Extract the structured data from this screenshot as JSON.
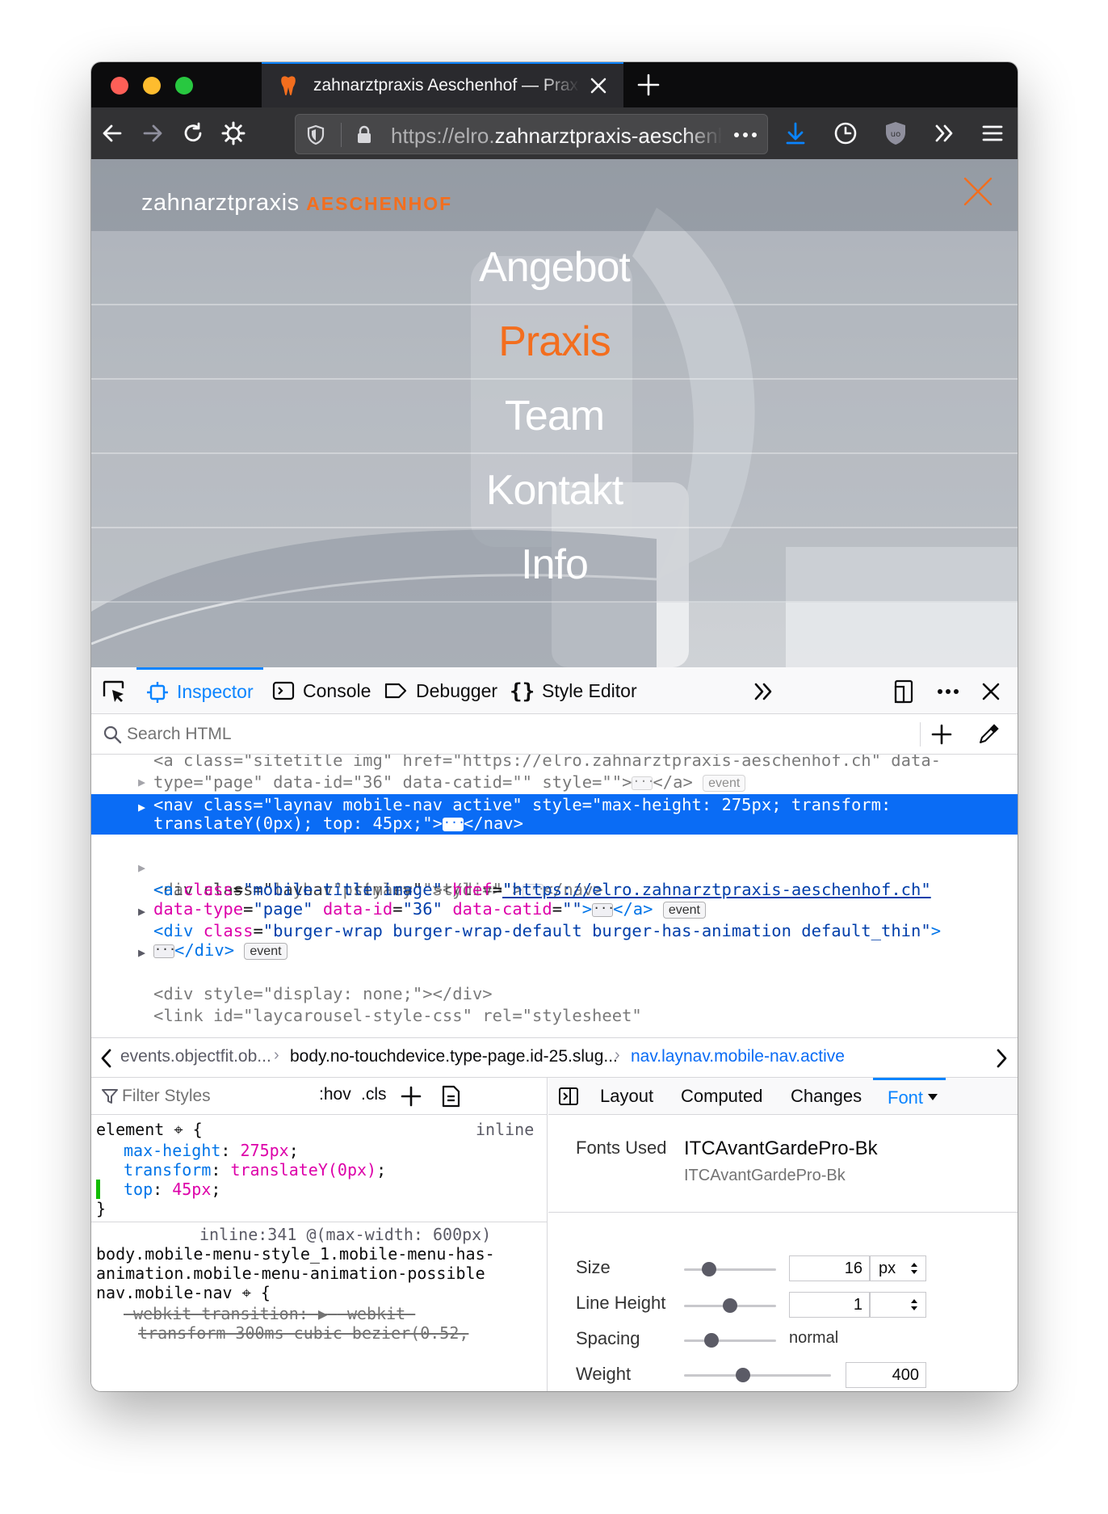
{
  "browser": {
    "tab_title": "zahnarztpraxis Aeschenhof — Praxis",
    "url_prefix": "https://elro.",
    "url_domain": "zahnarztpraxis-aeschenhof.ch"
  },
  "page": {
    "brand_light": "zahnarztpraxis ",
    "brand_bold": "AESCHENHOF",
    "accent_color": "#f36e1e",
    "menu": [
      {
        "label": "Angebot",
        "active": false
      },
      {
        "label": "Praxis",
        "active": true
      },
      {
        "label": "Team",
        "active": false
      },
      {
        "label": "Kontakt",
        "active": false
      },
      {
        "label": "Info",
        "active": false
      }
    ]
  },
  "devtools": {
    "tabs": {
      "inspector": "Inspector",
      "console": "Console",
      "debugger": "Debugger",
      "style_editor": "Style Editor"
    },
    "search_placeholder": "Search HTML",
    "markup": {
      "l0a": "<a class=\"sitetitle img\" href=\"https://elro.zahnarztpraxis-aeschenhof.ch\" data-",
      "l0b": "type=\"page\" data-id=\"36\" data-catid=\"\" style=\"\">",
      "l0c": "</a>",
      "sel1": "<nav class=\"laynav mobile-nav active\" style=\"max-height: 275px; transform:",
      "sel2": "translateY(0px); top: 45px;\">",
      "sel3": "</nav>",
      "l2a": "<nav class=\"laynav primary\" style=\"\">",
      "l2b": "</nav>",
      "l3": "<div class=\"navbar\" style=\"\"></div>",
      "l4_tag": "<a ",
      "l4_a1": "class",
      "l4_v1": "\"mobile-title image\"",
      "l4_a2": "href",
      "l4_v2": "\"https://elro.zahnarztpraxis-aeschenhof.ch\"",
      "l5_a1": "data-type",
      "l5_v1": "\"page\"",
      "l5_a2": "data-id",
      "l5_v2": "\"36\"",
      "l5_a3": "data-catid",
      "l5_v3": "\"\"",
      "l6_tag": "<div ",
      "l6_a1": "class",
      "l6_v1": "\"burger-wrap burger-wrap-default burger-has-animation default_thin\"",
      "l7": "</div>",
      "l8": "<div style=\"display: none;\"></div>",
      "l9": "<link id=\"laycarousel-style-css\" rel=\"stylesheet\"",
      "event_badge": "event"
    },
    "breadcrumbs": [
      "events.objectfit.ob...",
      "body.no-touchdevice.type-page.id-25.slug...",
      "nav.laynav.mobile-nav.active"
    ],
    "rules": {
      "filter_placeholder": "Filter Styles",
      "hov": ":hov",
      "cls": ".cls",
      "element_selector": "element",
      "inline_label": "inline",
      "decls": [
        {
          "prop": "max-height",
          "value": "275px"
        },
        {
          "prop": "transform",
          "value": "translateY(0px)"
        },
        {
          "prop": "top",
          "value": "45px"
        }
      ],
      "media_source": "inline:341 @(max-width: 600px)",
      "sel_line1": "body.mobile-menu-style_1.mobile-menu-has-",
      "sel_line2": "animation.mobile-menu-animation-possible",
      "sel_line3": "nav.mobile-nav",
      "struck1_prop": "-webkit-transition",
      "struck1_val": "-webkit-",
      "struck2": "transform 300ms cubic-bezier(0.52,"
    },
    "side_tabs": {
      "layout": "Layout",
      "computed": "Computed",
      "changes": "Changes",
      "font": "Font"
    },
    "fonts": {
      "used_label": "Fonts Used",
      "name": "ITCAvantGardePro-Bk",
      "name_sub": "ITCAvantGardePro-Bk",
      "size_label": "Size",
      "size_value": "16",
      "size_unit": "px",
      "size_level": 0.27,
      "line_height_label": "Line Height",
      "line_height_value": "1",
      "line_height_level": 0.5,
      "spacing_label": "Spacing",
      "spacing_value": "normal",
      "spacing_level": 0.3,
      "weight_label": "Weight",
      "weight_value": "400",
      "weight_level": 0.4
    }
  }
}
